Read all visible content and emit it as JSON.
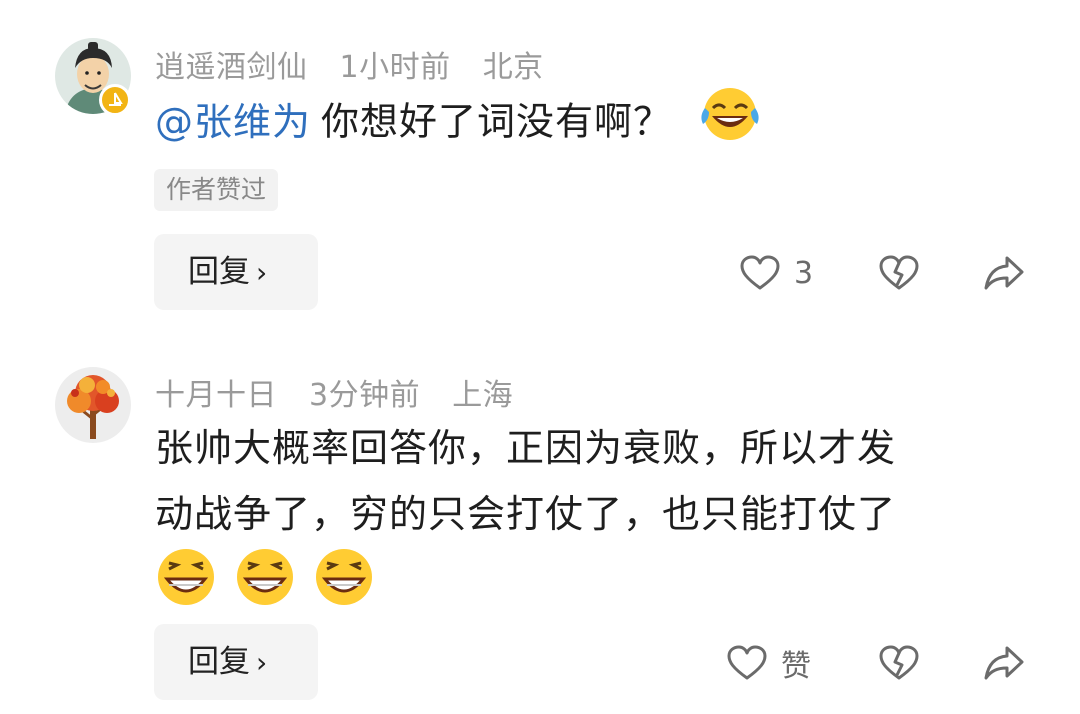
{
  "comments": [
    {
      "username": "逍遥酒剑仙",
      "time": "1小时前",
      "location": "北京",
      "mention": "@张维为",
      "text": "你想好了词没有啊？",
      "author_tag": "作者赞过",
      "reply_label": "回复",
      "like_count": "3"
    },
    {
      "username": "十月十日",
      "time": "3分钟前",
      "location": "上海",
      "text_line1": "张帅大概率回答你，正因为衰败，所以才发",
      "text_line2": "动战争了，穷的只会打仗了，也只能打仗了",
      "reply_label": "回复",
      "like_label": "赞"
    }
  ],
  "icons": [
    "heart-icon",
    "broken-heart-icon",
    "share-icon",
    "chevron-right-icon",
    "laugh-cry-emoji",
    "grin-emoji"
  ]
}
